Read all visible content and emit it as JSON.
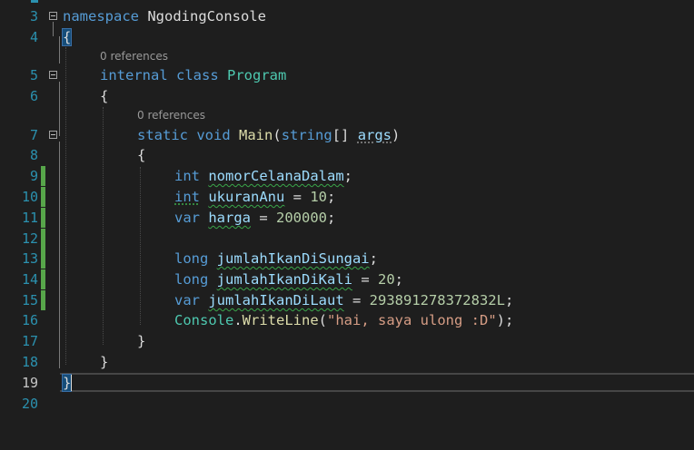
{
  "lines": [
    {
      "num": "3"
    },
    {
      "num": "4"
    },
    {
      "num": "5"
    },
    {
      "num": "6"
    },
    {
      "num": "7"
    },
    {
      "num": "8"
    },
    {
      "num": "9"
    },
    {
      "num": "10"
    },
    {
      "num": "11"
    },
    {
      "num": "12"
    },
    {
      "num": "13"
    },
    {
      "num": "14"
    },
    {
      "num": "15"
    },
    {
      "num": "16"
    },
    {
      "num": "17"
    },
    {
      "num": "18"
    },
    {
      "num": "19"
    },
    {
      "num": "20"
    }
  ],
  "codelens": {
    "class_refs": "0 references",
    "method_refs": "0 references"
  },
  "code": {
    "ns_kw": "namespace",
    "ns_name": "NgodingConsole",
    "open_brace": "{",
    "close_brace": "}",
    "internal_kw": "internal",
    "class_kw": "class",
    "class_name": "Program",
    "static_kw": "static",
    "void_kw": "void",
    "main_name": "Main",
    "string_kw": "string",
    "args_name": "args",
    "int_kw": "int",
    "var_kw": "var",
    "long_kw": "long",
    "v1": "nomorCelanaDalam",
    "v2": "ukuranAnu",
    "v2_val": "10",
    "v3": "harga",
    "v3_val": "200000",
    "v4": "jumlahIkanDiSungai",
    "v5": "jumlahIkanDiKali",
    "v5_val": "20",
    "v6": "jumlahIkanDiLaut",
    "v6_val": "293891278372832L",
    "console_type": "Console",
    "writeline": "WriteLine",
    "message": "\"hai, saya ulong :D\""
  },
  "colors": {
    "background": "#1e1e1e",
    "line_number": "#2b91af",
    "keyword": "#569cd6",
    "type": "#4ec9b0",
    "method": "#dcdcaa",
    "string": "#d69d85",
    "number": "#b5cea8",
    "change_bar": "#57a64a"
  }
}
